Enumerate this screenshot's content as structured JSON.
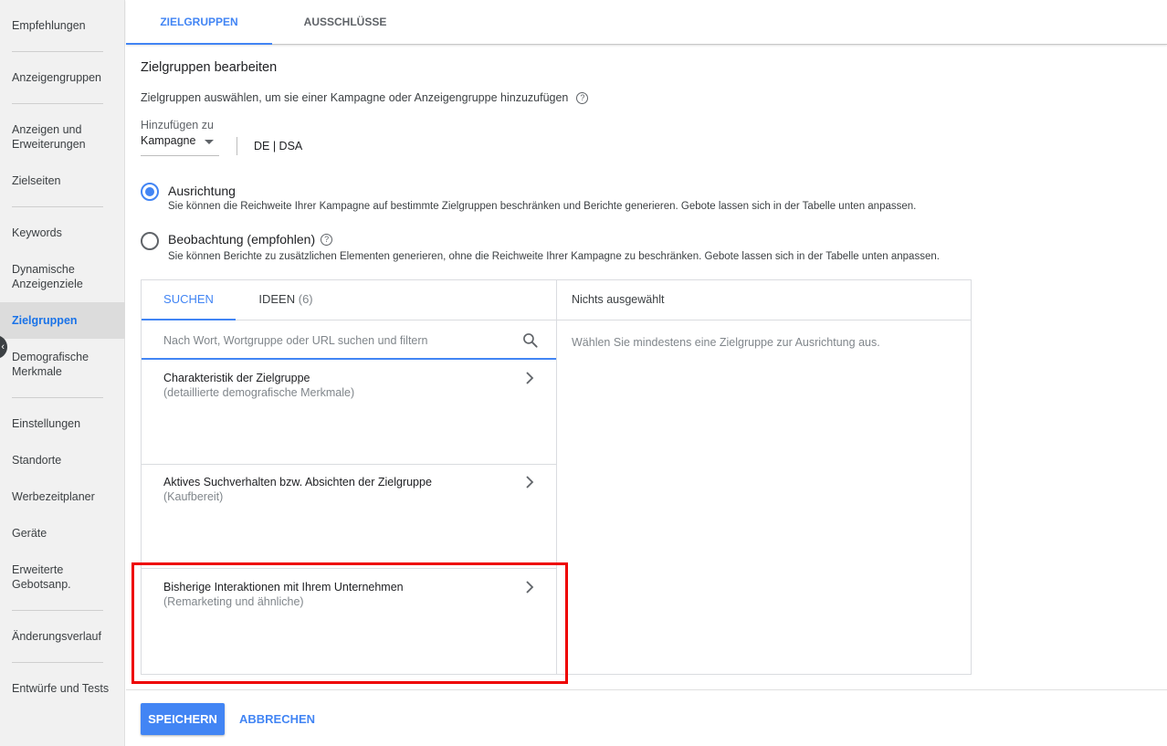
{
  "sidebar": {
    "items": [
      {
        "label": "Empfehlungen"
      },
      {
        "label": "Anzeigengruppen"
      },
      {
        "label": "Anzeigen und Erweiterungen"
      },
      {
        "label": "Zielseiten"
      },
      {
        "label": "Keywords"
      },
      {
        "label": "Dynamische Anzeigenziele"
      },
      {
        "label": "Zielgruppen",
        "active": true
      },
      {
        "label": "Demografische Merkmale"
      },
      {
        "label": "Einstellungen"
      },
      {
        "label": "Standorte"
      },
      {
        "label": "Werbezeitplaner"
      },
      {
        "label": "Geräte"
      },
      {
        "label": "Erweiterte Gebotsanp."
      },
      {
        "label": "Änderungsverlauf"
      },
      {
        "label": "Entwürfe und Tests"
      }
    ],
    "collapse_icon": "chevron-left-icon"
  },
  "top_tabs": [
    {
      "label": "ZIELGRUPPEN",
      "active": true
    },
    {
      "label": "AUSSCHLÜSSE",
      "active": false
    }
  ],
  "main": {
    "title": "Zielgruppen bearbeiten",
    "subtitle": "Zielgruppen auswählen, um sie einer Kampagne oder Anzeigengruppe hinzuzufügen",
    "help_icon": "?",
    "add_to": {
      "label": "Hinzufügen zu",
      "value": "Kampagne",
      "campaign": "DE | DSA"
    },
    "options": [
      {
        "label": "Ausrichtung",
        "description": "Sie können die Reichweite Ihrer Kampagne auf bestimmte Zielgruppen beschränken und Berichte generieren. Gebote lassen sich in der Tabelle unten anpassen.",
        "checked": true
      },
      {
        "label": "Beobachtung (empfohlen)",
        "description": "Sie können Berichte zu zusätzlichen Elementen generieren, ohne die Reichweite Ihrer Kampagne zu beschränken. Gebote lassen sich in der Tabelle unten anpassen.",
        "checked": false
      }
    ]
  },
  "picker": {
    "tabs": [
      {
        "label": "SUCHEN",
        "active": true
      },
      {
        "label": "IDEEN",
        "count": "(6)",
        "active": false
      }
    ],
    "search_placeholder": "Nach Wort, Wortgruppe oder URL suchen und filtern",
    "categories": [
      {
        "title": "Charakteristik der Zielgruppe",
        "subtitle": "(detaillierte demografische Merkmale)"
      },
      {
        "title": "Aktives Suchverhalten bzw. Absichten der Zielgruppe",
        "subtitle": "(Kaufbereit)"
      },
      {
        "title": "Bisherige Interaktionen mit Ihrem Unternehmen",
        "subtitle": "(Remarketing und ähnliche)"
      }
    ],
    "selected_header": "Nichts ausgewählt",
    "selected_empty": "Wählen Sie mindestens eine Zielgruppe zur Ausrichtung aus."
  },
  "footer": {
    "save_label": "SPEICHERN",
    "cancel_label": "ABBRECHEN"
  },
  "colors": {
    "accent": "#4285f4",
    "highlight": "#ee0000"
  }
}
